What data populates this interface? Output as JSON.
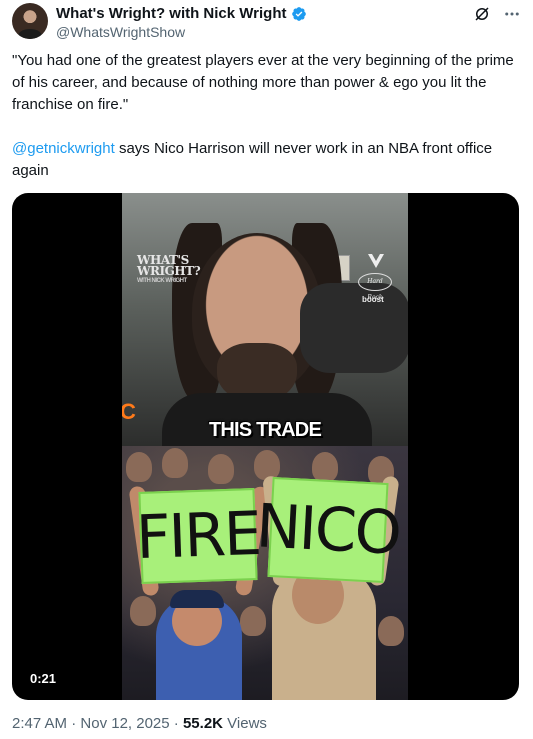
{
  "author": {
    "display_name": "What's Wright? with Nick Wright",
    "handle": "@WhatsWrightShow",
    "verified": true,
    "verified_color": "#1d9bf0"
  },
  "tweet": {
    "quote": "\"You had one of the greatest players ever at the very beginning of the prime of his career, and because of nothing more than power & ego you lit the franchise on fire.\"",
    "mention": "@getnickwright",
    "body_after_mention": " says Nico Harrison will never work in an NBA front office again"
  },
  "media": {
    "caption": "THIS TRADE",
    "show_logo_line1": "WHAT'S",
    "show_logo_line2": "WRIGHT?",
    "show_logo_tag": "WITH NICK WRIGHT",
    "sponsor_hardrock": "Hard Rock",
    "sponsor_boost": "boost",
    "sign_left": "FIRE",
    "sign_right": "NICO",
    "duration": "0:21"
  },
  "meta": {
    "time": "2:47 AM",
    "separator": " · ",
    "date": "Nov 12, 2025",
    "views_count": "55.2K",
    "views_label": " Views"
  },
  "icons": {
    "grok": "grok-icon",
    "more": "more-icon",
    "verified": "verified-badge-icon"
  },
  "colors": {
    "link": "#1d9bf0",
    "secondary_text": "#536471",
    "sign_green": "#a8f07a"
  }
}
